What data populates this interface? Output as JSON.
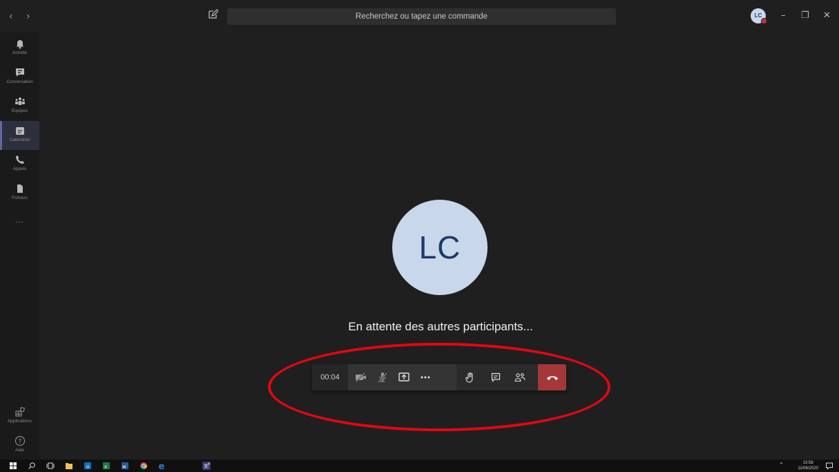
{
  "titlebar": {
    "search_placeholder": "Recherchez ou tapez une commande",
    "avatar_initials": "LC",
    "minimize": "–",
    "maximize": "❐",
    "close": "✕",
    "back": "‹",
    "forward": "›"
  },
  "rail": {
    "items": [
      {
        "label": "Activité",
        "icon": "bell-icon"
      },
      {
        "label": "Conversation",
        "icon": "chat-icon"
      },
      {
        "label": "Équipes",
        "icon": "teams-icon"
      },
      {
        "label": "Calendrier",
        "icon": "calendar-icon",
        "active": true
      },
      {
        "label": "Appels",
        "icon": "phone-icon"
      },
      {
        "label": "Fichiers",
        "icon": "file-icon"
      }
    ],
    "more": "...",
    "bottom": [
      {
        "label": "Applications",
        "icon": "apps-icon"
      },
      {
        "label": "Aide",
        "icon": "help-icon"
      }
    ]
  },
  "stage": {
    "avatar_initials": "LC",
    "waiting_text": "En attente des autres participants..."
  },
  "toolbar": {
    "timer": "00:04",
    "buttons": [
      "camera-off-icon",
      "mic-off-icon",
      "share-screen-icon",
      "more-options-icon",
      "raise-hand-icon",
      "chat-icon",
      "participants-icon",
      "hang-up-icon"
    ]
  },
  "taskbar": {
    "time": "13:58",
    "date": "11/06/2020"
  },
  "colors": {
    "accent": "#6264a7",
    "hangup": "#a4373a",
    "annotation": "#e30613",
    "avatar_bg": "#c9d7ea"
  }
}
